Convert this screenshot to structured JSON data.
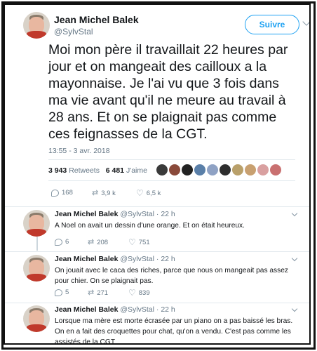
{
  "main_tweet": {
    "author_name": "Jean Michel Balek",
    "author_handle": "@SylvStal",
    "follow_label": "Suivre",
    "text": "Moi mon père il travaillait 22 heures par jour et on mangeait des cailloux a la mayonnaise. Je l'ai vu que 3 fois dans ma vie avant qu'il ne meure au travail à 28 ans. Et on se plaignait pas comme ces feignasses de la CGT.",
    "timestamp": "13:55 - 3 avr. 2018",
    "retweets_count": "3 943",
    "retweets_label": "Retweets",
    "likes_count": "6 481",
    "likes_label": "J'aime",
    "likers": [
      "#3a3a3a",
      "#8a4a3a",
      "#222222",
      "#5a7fa8",
      "#8fa2c4",
      "#2e2e2e",
      "#b9a06a",
      "#c8a070",
      "#d9a0a0",
      "#c97070"
    ],
    "actions": {
      "replies": "168",
      "retweets": "3,9 k",
      "likes": "6,5 k"
    }
  },
  "replies": [
    {
      "author_name": "Jean Michel Balek",
      "author_handle": "@SylvStal",
      "time": "· 22 h",
      "text": "A Noel on avait un dessin d'une orange. Et on était heureux.",
      "actions": {
        "replies": "6",
        "retweets": "208",
        "likes": "751"
      }
    },
    {
      "author_name": "Jean Michel Balek",
      "author_handle": "@SylvStal",
      "time": "· 22 h",
      "text": "On jouait avec le caca des riches, parce que nous on mangeait pas assez pour chier. On se plaignait pas.",
      "actions": {
        "replies": "5",
        "retweets": "271",
        "likes": "839"
      }
    },
    {
      "author_name": "Jean Michel Balek",
      "author_handle": "@SylvStal",
      "time": "· 22 h",
      "text": "Lorsque ma mère est morte écrasée par un piano on a pas baissé les bras. On en a fait des croquettes pour chat, qu'on a vendu. C'est pas comme les assistés de la CGT",
      "actions": {}
    }
  ],
  "colors": {
    "accent": "#1da1f2",
    "secondary_text": "#657786",
    "divider": "#e1e8ed"
  }
}
